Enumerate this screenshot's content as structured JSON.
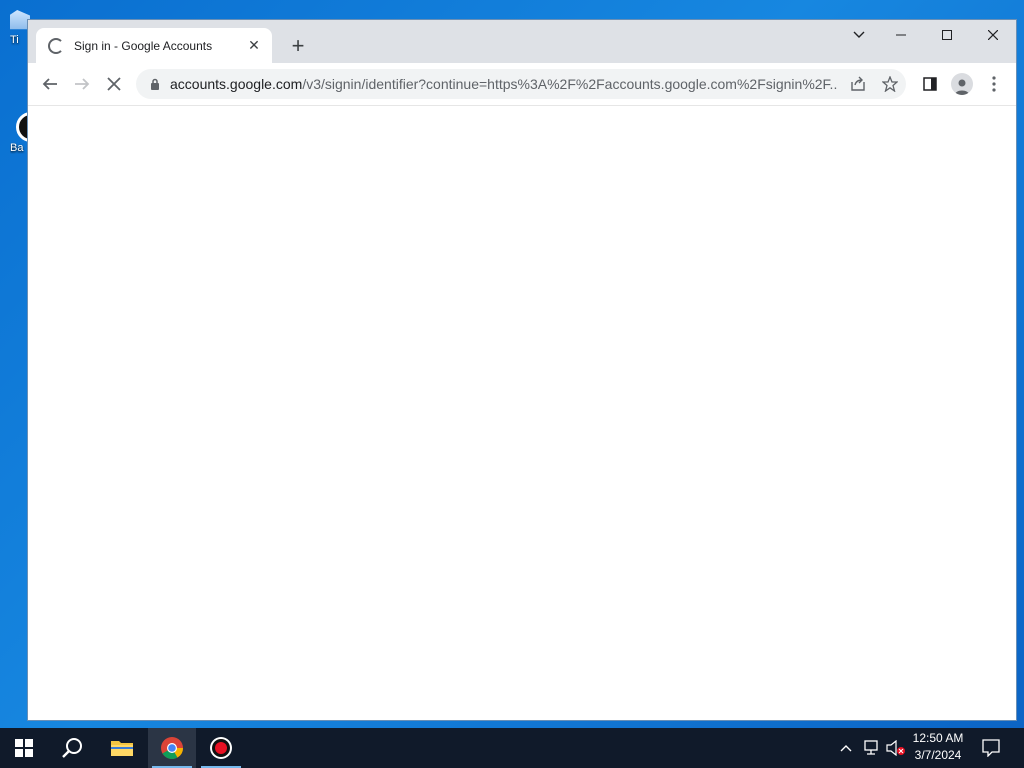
{
  "desktop": {
    "icons": [
      {
        "label": "Ti",
        "icon": "recycle-bin-icon"
      },
      {
        "label": "Ba",
        "icon": "app-shortcut-icon"
      }
    ]
  },
  "browser": {
    "tab": {
      "title": "Sign in - Google Accounts",
      "loading": true
    },
    "new_tab_label": "+",
    "address": {
      "host": "accounts.google.com",
      "path": "/v3/signin/identifier?continue=https%3A%2F%2Faccounts.google.com%2Fsignin%2F..."
    }
  },
  "taskbar": {
    "apps": [
      "start-icon",
      "search-icon",
      "file-explorer-icon",
      "chrome-icon",
      "screen-recorder-icon"
    ],
    "clock": {
      "time": "12:50 AM",
      "date": "3/7/2024"
    }
  },
  "colors": {
    "accent": "#1a73e8",
    "taskbar": "#101a2a",
    "tabstrip": "#dee1e6"
  }
}
